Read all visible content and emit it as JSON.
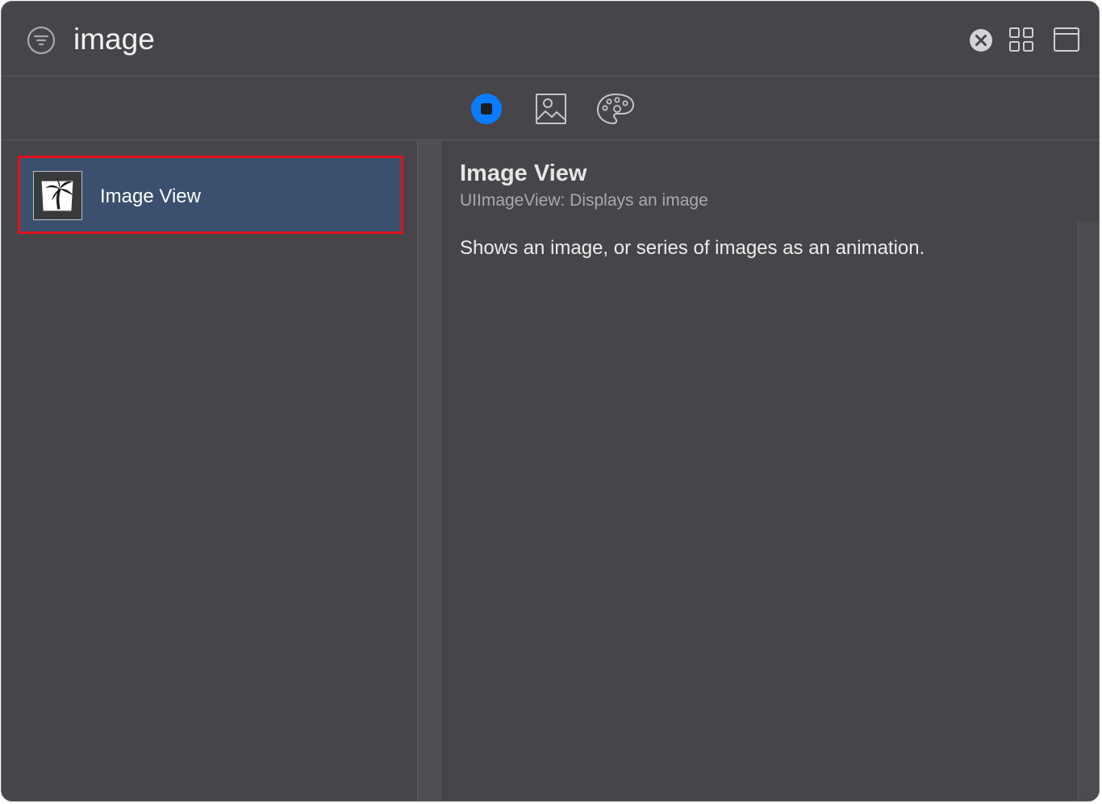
{
  "search": {
    "value": "image",
    "filter_icon": "filter-icon",
    "clear_icon": "clear-circle-icon"
  },
  "header_buttons": {
    "grid_icon": "grid-view-icon",
    "window_icon": "window-icon"
  },
  "segments": [
    {
      "name": "objects",
      "icon": "objects-library-icon",
      "selected": true
    },
    {
      "name": "media",
      "icon": "media-library-icon",
      "selected": false
    },
    {
      "name": "colors",
      "icon": "color-palette-icon",
      "selected": false
    }
  ],
  "library_items": [
    {
      "label": "Image View",
      "icon": "image-view-thumbnail-icon",
      "selected": true
    }
  ],
  "detail": {
    "title": "Image View",
    "subtitle": "UIImageView: Displays an image",
    "description": "Shows an image, or series of images as an animation."
  },
  "colors": {
    "background": "#474549",
    "selection": "#3a506e",
    "highlight_border": "#e0101a",
    "accent": "#0a7cff"
  }
}
